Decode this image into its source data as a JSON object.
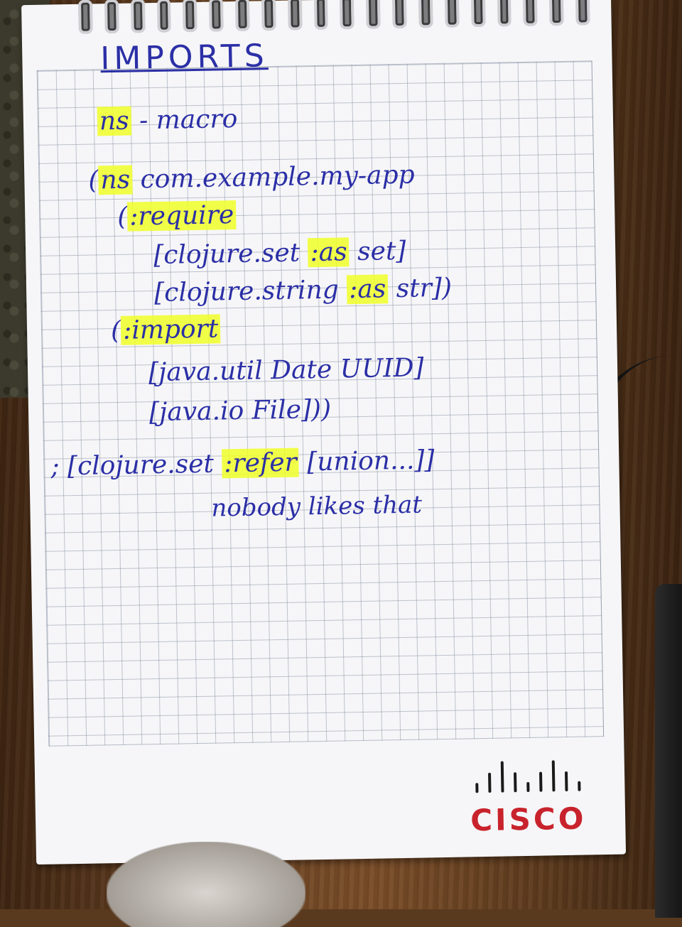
{
  "note": {
    "title": "IMPORTS",
    "line_ns": "ns",
    "line_macro": "- macro",
    "line_paren": "(",
    "line_ns2": "ns",
    "line_ns_rest": " com.example.my-app",
    "line_require_paren": "(",
    "line_require": ":require",
    "line_set_a": "[clojure.set ",
    "line_set_as": ":as",
    "line_set_b": " set]",
    "line_str_a": "[clojure.string ",
    "line_str_as": ":as",
    "line_str_b": " str])",
    "line_import_paren": "(",
    "line_import": ":import",
    "line_util": "[java.util Date UUID]",
    "line_io": "[java.io File]))",
    "line_refer_a": "; [clojure.set ",
    "line_refer": ":refer",
    "line_refer_b": " [union...]]",
    "line_nobody": "nobody likes that"
  },
  "logo": {
    "text": "CISCO"
  },
  "colors": {
    "ink": "#2b2fa6",
    "highlight": "#f0ff28",
    "logo_red": "#c8232c"
  }
}
